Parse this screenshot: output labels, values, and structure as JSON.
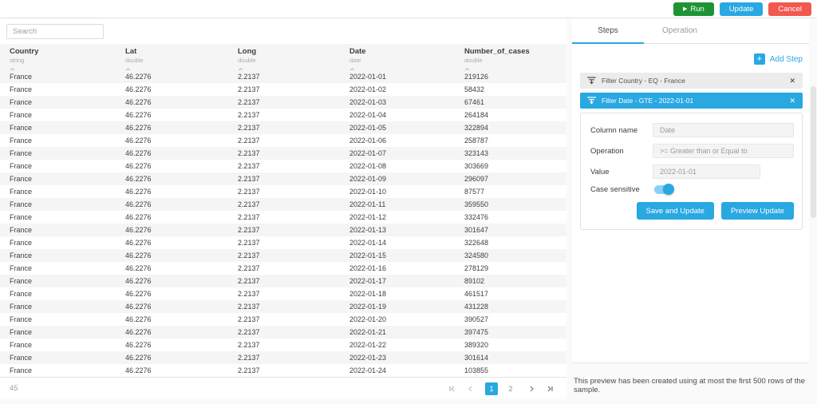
{
  "colors": {
    "accent": "#29A8E2",
    "green": "#1D9434",
    "red": "#F1584E"
  },
  "icons": {
    "play": "▶",
    "plus": "+",
    "close": "✕",
    "filter": "filter-funnel-icon",
    "sort": "sort-arrows-icon",
    "first_page": "first-page-icon",
    "prev_page": "chevron-left-icon",
    "next_page": "chevron-right-icon",
    "last_page": "last-page-icon"
  },
  "topbar": {
    "run_label": "Run",
    "update_label": "Update",
    "cancel_label": "Cancel"
  },
  "search": {
    "placeholder": "Search"
  },
  "table": {
    "columns": [
      {
        "name": "Country",
        "type": "string"
      },
      {
        "name": "Lat",
        "type": "double"
      },
      {
        "name": "Long",
        "type": "double"
      },
      {
        "name": "Date",
        "type": "date"
      },
      {
        "name": "Number_of_cases",
        "type": "double"
      }
    ],
    "rows": [
      [
        "France",
        "46.2276",
        "2.2137",
        "2022-01-01",
        "219126"
      ],
      [
        "France",
        "46.2276",
        "2.2137",
        "2022-01-02",
        "58432"
      ],
      [
        "France",
        "46.2276",
        "2.2137",
        "2022-01-03",
        "67461"
      ],
      [
        "France",
        "46.2276",
        "2.2137",
        "2022-01-04",
        "264184"
      ],
      [
        "France",
        "46.2276",
        "2.2137",
        "2022-01-05",
        "322894"
      ],
      [
        "France",
        "46.2276",
        "2.2137",
        "2022-01-06",
        "258787"
      ],
      [
        "France",
        "46.2276",
        "2.2137",
        "2022-01-07",
        "323143"
      ],
      [
        "France",
        "46.2276",
        "2.2137",
        "2022-01-08",
        "303669"
      ],
      [
        "France",
        "46.2276",
        "2.2137",
        "2022-01-09",
        "296097"
      ],
      [
        "France",
        "46.2276",
        "2.2137",
        "2022-01-10",
        "87577"
      ],
      [
        "France",
        "46.2276",
        "2.2137",
        "2022-01-11",
        "359550"
      ],
      [
        "France",
        "46.2276",
        "2.2137",
        "2022-01-12",
        "332476"
      ],
      [
        "France",
        "46.2276",
        "2.2137",
        "2022-01-13",
        "301647"
      ],
      [
        "France",
        "46.2276",
        "2.2137",
        "2022-01-14",
        "322648"
      ],
      [
        "France",
        "46.2276",
        "2.2137",
        "2022-01-15",
        "324580"
      ],
      [
        "France",
        "46.2276",
        "2.2137",
        "2022-01-16",
        "278129"
      ],
      [
        "France",
        "46.2276",
        "2.2137",
        "2022-01-17",
        "89102"
      ],
      [
        "France",
        "46.2276",
        "2.2137",
        "2022-01-18",
        "461517"
      ],
      [
        "France",
        "46.2276",
        "2.2137",
        "2022-01-19",
        "431228"
      ],
      [
        "France",
        "46.2276",
        "2.2137",
        "2022-01-20",
        "390527"
      ],
      [
        "France",
        "46.2276",
        "2.2137",
        "2022-01-21",
        "397475"
      ],
      [
        "France",
        "46.2276",
        "2.2137",
        "2022-01-22",
        "389320"
      ],
      [
        "France",
        "46.2276",
        "2.2137",
        "2022-01-23",
        "301614"
      ],
      [
        "France",
        "46.2276",
        "2.2137",
        "2022-01-24",
        "103855"
      ]
    ],
    "total": "45"
  },
  "pagination": {
    "pages": [
      "1",
      "2"
    ],
    "active_index": 0
  },
  "panel": {
    "tabs": [
      "Steps",
      "Operation"
    ],
    "active_tab": "Steps",
    "add_step_label": "Add Step",
    "steps": [
      {
        "label": "Filter Country - EQ - France",
        "selected": false
      },
      {
        "label": "Filter Date - GTE - 2022-01-01",
        "selected": true
      }
    ],
    "form": {
      "column_name_label": "Column name",
      "column_name_value": "Date",
      "operation_label": "Operation",
      "operation_value": ">= Greater than or Equal to",
      "value_label": "Value",
      "value_value": "2022-01-01",
      "case_sensitive_label": "Case sensitive",
      "case_sensitive_on": true,
      "save_label": "Save and Update",
      "preview_label": "Preview Update"
    }
  },
  "footer_note": "This preview has been created using at most the first 500 rows of the sample."
}
